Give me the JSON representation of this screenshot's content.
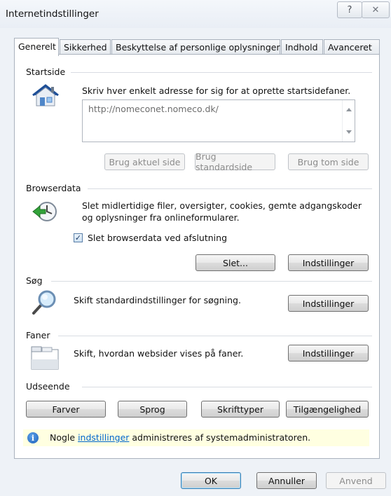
{
  "window": {
    "title": "Internetindstillinger",
    "help_glyph": "?",
    "close_glyph": "✕"
  },
  "tabs": [
    {
      "label": "Generelt",
      "active": true
    },
    {
      "label": "Sikkerhed",
      "active": false
    },
    {
      "label": "Beskyttelse af personlige oplysninger",
      "active": false
    },
    {
      "label": "Indhold",
      "active": false
    },
    {
      "label": "Avanceret",
      "active": false
    }
  ],
  "startside": {
    "title": "Startside",
    "instruction": "Skriv hver enkelt adresse for sig for at oprette startsidefaner.",
    "url": "http://nomeconet.nomeco.dk/",
    "buttons": {
      "current": "Brug aktuel side",
      "default": "Brug standardside",
      "blank": "Brug tom side"
    }
  },
  "browserdata": {
    "title": "Browserdata",
    "description": "Slet midlertidige filer, oversigter, cookies, gemte adgangskoder og oplysninger fra onlineformularer.",
    "checkbox_label": "Slet browserdata ved afslutning",
    "checked": true,
    "delete_button": "Slet...",
    "settings_button": "Indstillinger"
  },
  "sog": {
    "title": "Søg",
    "description": "Skift standardindstillinger for søgning.",
    "settings_button": "Indstillinger"
  },
  "faner": {
    "title": "Faner",
    "description": "Skift, hvordan websider vises på faner.",
    "settings_button": "Indstillinger"
  },
  "udseende": {
    "title": "Udseende",
    "buttons": {
      "colors": "Farver",
      "language": "Sprog",
      "fonts": "Skrifttyper",
      "accessibility": "Tilgængelighed"
    }
  },
  "info": {
    "prefix": "Nogle ",
    "link": "indstillinger",
    "suffix": " administreres af systemadministratoren."
  },
  "footer": {
    "ok": "OK",
    "cancel": "Annuller",
    "apply": "Anvend"
  },
  "colors": {
    "accent": "#1f5fb8",
    "info_bg": "#ffffe1",
    "link": "#0066cc"
  }
}
